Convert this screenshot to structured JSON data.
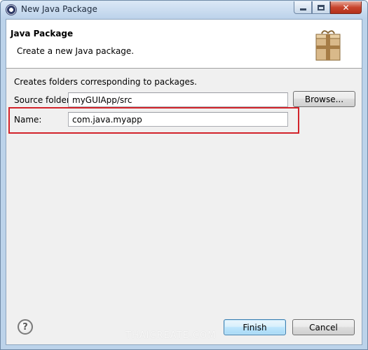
{
  "window": {
    "title": "New Java Package",
    "icon": "eclipse-icon"
  },
  "title_buttons": {
    "minimize": "minimize-icon",
    "maximize": "maximize-icon",
    "close_label": "✕"
  },
  "banner": {
    "title": "Java Package",
    "subtitle": "Create a new Java package.",
    "icon": "package-icon"
  },
  "form": {
    "description": "Creates folders corresponding to packages.",
    "source_folder": {
      "label": "Source folder:",
      "value": "myGUIApp/src"
    },
    "browse_label": "Browse...",
    "name": {
      "label": "Name:",
      "value": "com.java.myapp"
    },
    "highlight_color": "#d2232a"
  },
  "footer": {
    "help_label": "?",
    "finish_label": "Finish",
    "cancel_label": "Cancel",
    "watermark": "THAICREATE.COM"
  }
}
